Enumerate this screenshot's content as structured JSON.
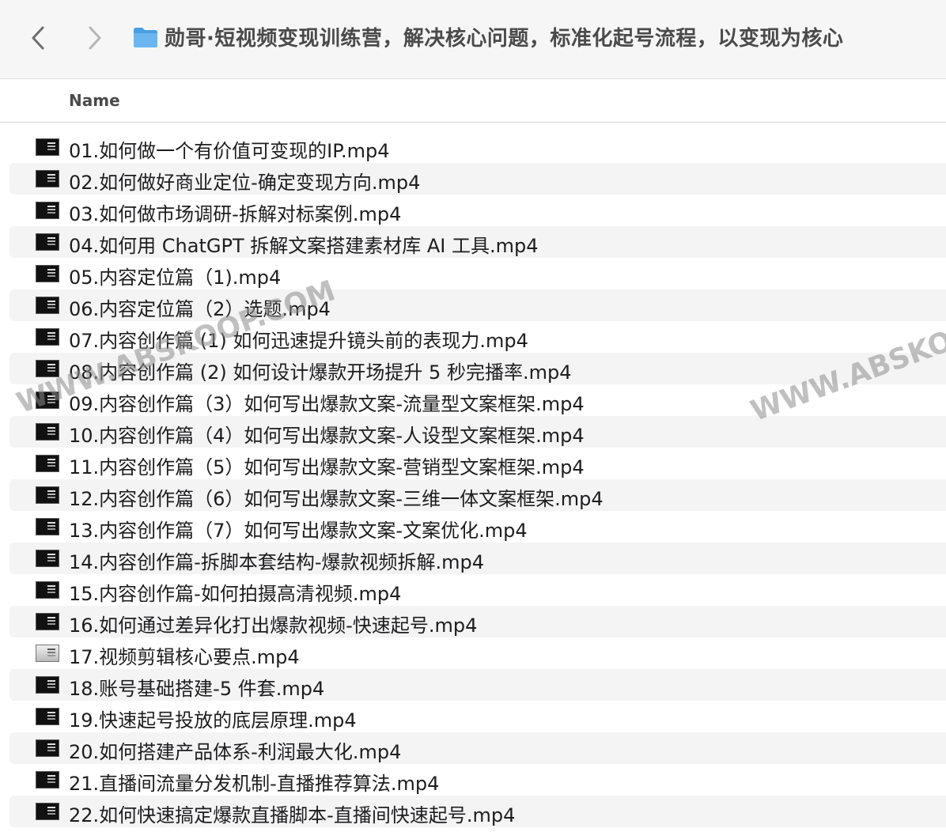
{
  "window": {
    "title": "勋哥·短视频变现训练营，解决核心问题，标准化起号流程，以变现为核心",
    "folder_icon": "folder-icon",
    "folder_color": "#5aa9e6"
  },
  "toolbar": {
    "back_icon": "chevron-left-icon",
    "forward_icon": "chevron-right-icon"
  },
  "columns": {
    "name": "Name"
  },
  "files": [
    {
      "name": "01.如何做一个有价值可变现的IP.mp4",
      "icon": "video-file-icon"
    },
    {
      "name": "02.如何做好商业定位-确定变现方向.mp4",
      "icon": "video-file-icon"
    },
    {
      "name": "03.如何做市场调研-拆解对标案例.mp4",
      "icon": "video-file-icon"
    },
    {
      "name": "04.如何用 ChatGPT 拆解文案搭建素材库 AI 工具.mp4",
      "icon": "video-file-icon"
    },
    {
      "name": "05.内容定位篇（1).mp4",
      "icon": "video-file-icon"
    },
    {
      "name": "06.内容定位篇（2）选题.mp4",
      "icon": "video-file-icon"
    },
    {
      "name": "07.内容创作篇 (1) 如何迅速提升镜头前的表现力.mp4",
      "icon": "video-file-icon"
    },
    {
      "name": "08.内容创作篇 (2) 如何设计爆款开场提升 5 秒完播率.mp4",
      "icon": "video-file-icon"
    },
    {
      "name": "09.内容创作篇（3）如何写出爆款文案-流量型文案框架.mp4",
      "icon": "video-file-icon"
    },
    {
      "name": "10.内容创作篇（4）如何写出爆款文案-人设型文案框架.mp4",
      "icon": "video-file-icon"
    },
    {
      "name": "11.内容创作篇（5）如何写出爆款文案-营销型文案框架.mp4",
      "icon": "video-file-icon"
    },
    {
      "name": "12.内容创作篇（6）如何写出爆款文案-三维一体文案框架.mp4",
      "icon": "video-file-icon"
    },
    {
      "name": "13.内容创作篇（7）如何写出爆款文案-文案优化.mp4",
      "icon": "video-file-icon"
    },
    {
      "name": "14.内容创作篇-拆脚本套结构-爆款视频拆解.mp4",
      "icon": "video-file-icon"
    },
    {
      "name": "15.内容创作篇-如何拍摄高清视频.mp4",
      "icon": "video-file-icon"
    },
    {
      "name": "16.如何通过差异化打出爆款视频-快速起号.mp4",
      "icon": "video-file-icon"
    },
    {
      "name": "17.视频剪辑核心要点.mp4",
      "icon": "video-file-icon-light"
    },
    {
      "name": "18.账号基础搭建-5 件套.mp4",
      "icon": "video-file-icon"
    },
    {
      "name": "19.快速起号投放的底层原理.mp4",
      "icon": "video-file-icon"
    },
    {
      "name": "20.如何搭建产品体系-利润最大化.mp4",
      "icon": "video-file-icon"
    },
    {
      "name": "21.直播间流量分发机制-直播推荐算法.mp4",
      "icon": "video-file-icon"
    },
    {
      "name": "22.如何快速搞定爆款直播脚本-直播间快速起号.mp4",
      "icon": "video-file-icon"
    }
  ],
  "watermarks": {
    "text_1": "WWW.ABSKOOP.COM",
    "text_2": "WWW.ABSKO",
    "text_3": "WW",
    "text_4": "WW"
  }
}
